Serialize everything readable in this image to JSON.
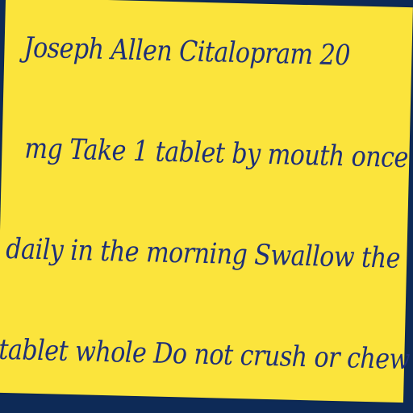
{
  "colors": {
    "background": "#0d2a57",
    "note": "#fbe43c",
    "ink": "#1e2f78"
  },
  "note": {
    "lines": [
      "Joseph Allen Citalopram 20",
      "mg Take 1 tablet by mouth once",
      "daily in the morning Swallow the",
      "tablet whole Do not crush or chew"
    ]
  }
}
